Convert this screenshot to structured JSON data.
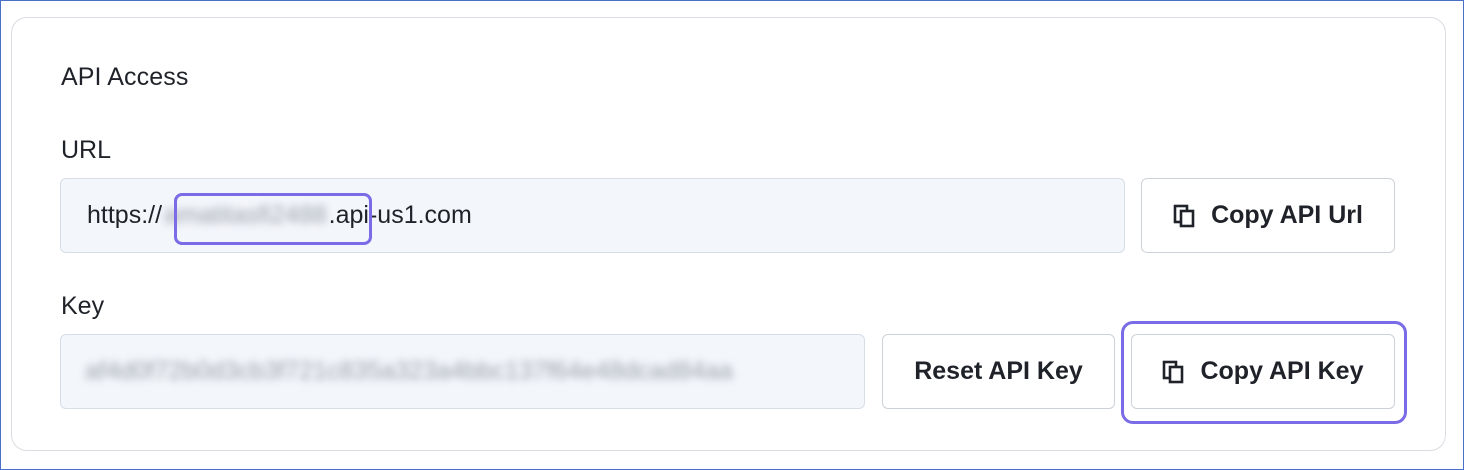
{
  "section": {
    "title": "API Access"
  },
  "url": {
    "label": "URL",
    "prefix": "https://",
    "masked_subdomain": "amatitasfi2488",
    "suffix": ".api-us1.com",
    "copy_button": "Copy API Url",
    "copy_icon": "copy-icon"
  },
  "key": {
    "label": "Key",
    "masked_value": "af4d0f72b0d3cb3f721c835a323a4bbc137f64e48dcad84aa",
    "reset_button": "Reset API Key",
    "copy_button": "Copy API Key",
    "copy_icon": "copy-icon"
  },
  "colors": {
    "highlight": "#7a6be6",
    "input_bg": "#f3f6fb",
    "border": "#d9dce1"
  }
}
